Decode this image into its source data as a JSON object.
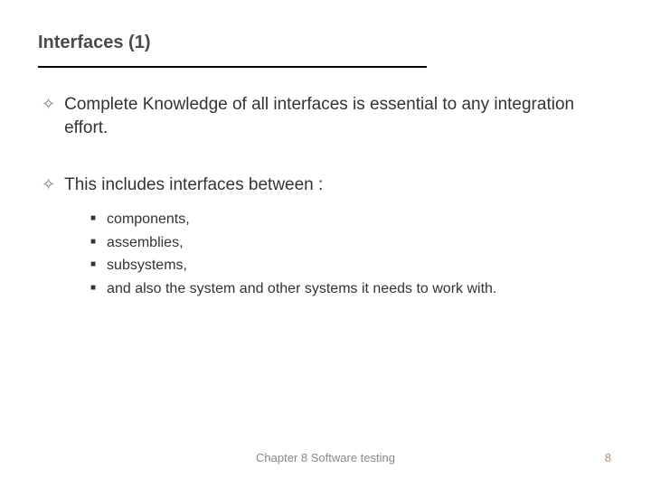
{
  "title": "Interfaces (1)",
  "bullets": {
    "b1": "Complete Knowledge of all interfaces is essential to any integration effort.",
    "b2": "This includes interfaces between :"
  },
  "sub": {
    "s1": "components,",
    "s2": "assemblies,",
    "s3": "subsystems,",
    "s4": "and also the system and other systems it needs to work with."
  },
  "footer": {
    "chapter": "Chapter 8 Software testing",
    "page": "8"
  }
}
